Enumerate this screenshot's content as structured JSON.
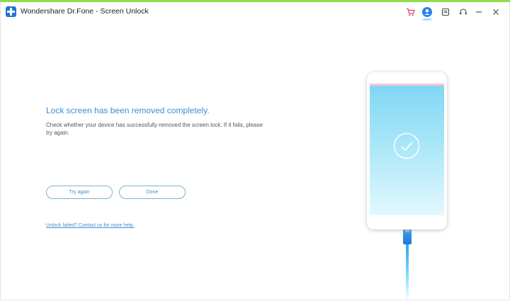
{
  "window": {
    "title": "Wondershare Dr.Fone - Screen Unlock"
  },
  "titlebar": {
    "icons": [
      "cart-icon",
      "account-icon",
      "feedback-icon",
      "support-headset-icon",
      "minimize-icon",
      "close-icon"
    ]
  },
  "main": {
    "heading": "Lock screen has been removed completely.",
    "description": "Check whether your device has successfully removed the screen lock. If it fails, please try again.",
    "try_again_label": "Try again",
    "done_label": "Done",
    "help_link": "Unlock failed? Contact us for more help."
  },
  "colors": {
    "accent": "#3f8ecf",
    "top_bar": "#8fdc4f",
    "account": "#2a80f0",
    "cart": "#e0457b"
  }
}
